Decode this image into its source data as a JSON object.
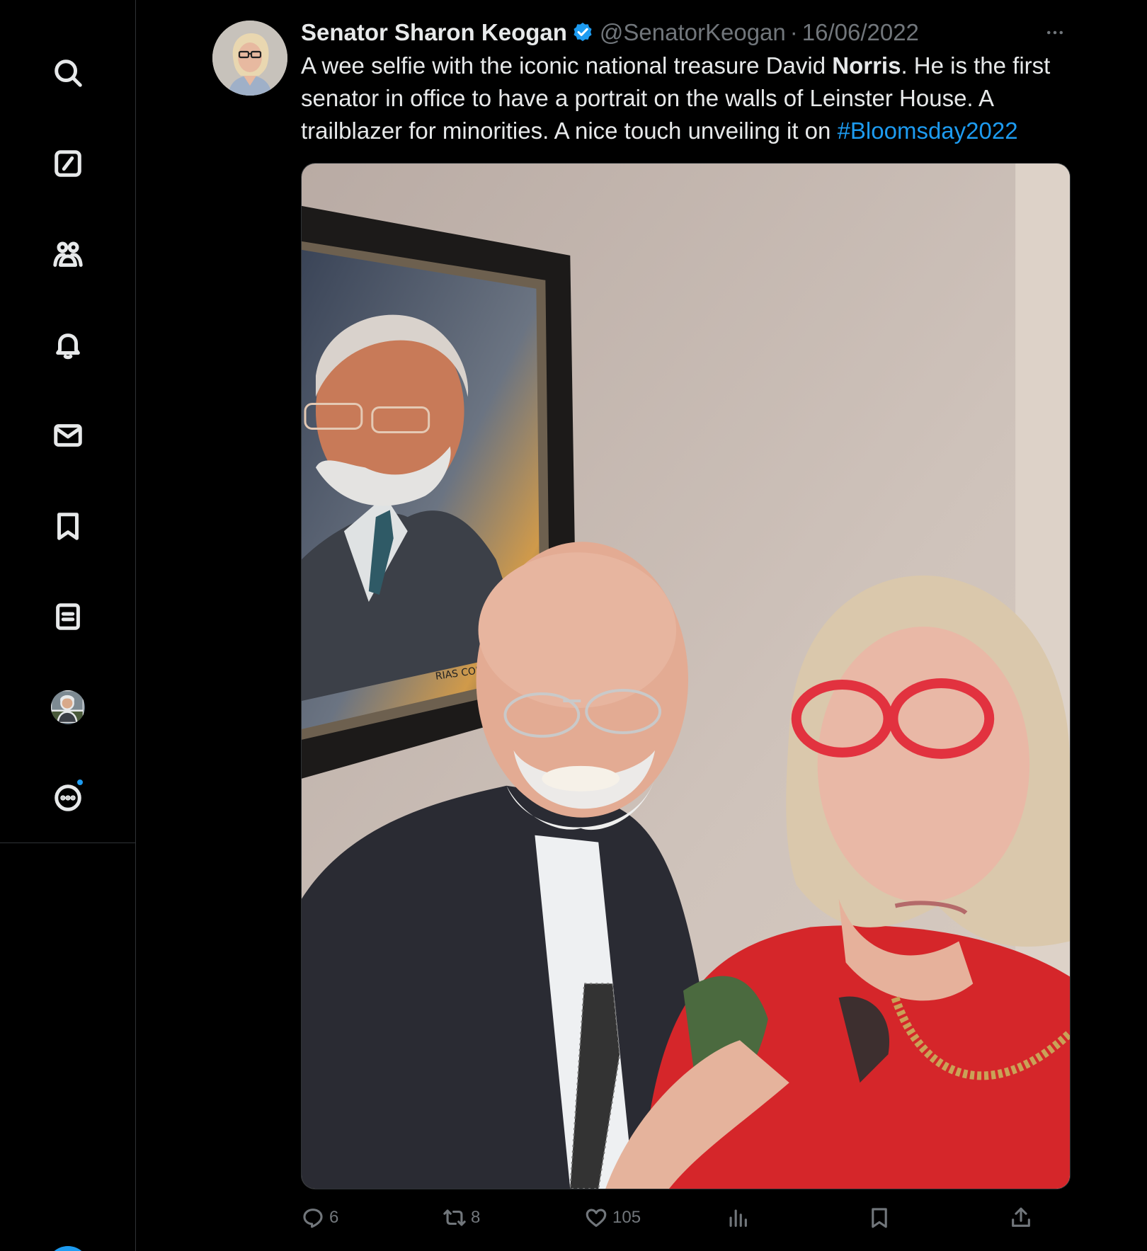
{
  "sidebar": {
    "items": [
      {
        "name": "search-icon"
      },
      {
        "name": "grok-icon"
      },
      {
        "name": "communities-icon"
      },
      {
        "name": "notifications-icon"
      },
      {
        "name": "messages-icon"
      },
      {
        "name": "bookmarks-icon"
      },
      {
        "name": "lists-icon"
      },
      {
        "name": "profile-avatar"
      },
      {
        "name": "more-icon",
        "has_badge": true
      }
    ]
  },
  "tweet": {
    "author": {
      "display_name": "Senator Sharon Keogan",
      "handle": "@SenatorKeogan",
      "verified": true
    },
    "separator": "·",
    "date": "16/06/2022",
    "text": {
      "part1": "A wee selfie with the iconic national treasure David ",
      "bold": "Norris",
      "part2": ". He is the first senator in office to have a portrait on the walls of Leinster House. A trailblazer for minorities. A nice touch unveiling it on ",
      "hashtag": "#Bloomsday2022"
    },
    "media": {
      "type": "photo",
      "painting_signature": "RIAS CONTAHAN"
    },
    "stats": {
      "replies": "6",
      "reposts": "8",
      "likes": "105"
    }
  },
  "colors": {
    "background": "#000000",
    "text": "#e7e9ea",
    "secondary": "#71767b",
    "accent": "#1d9bf0",
    "border": "#2f3336"
  }
}
